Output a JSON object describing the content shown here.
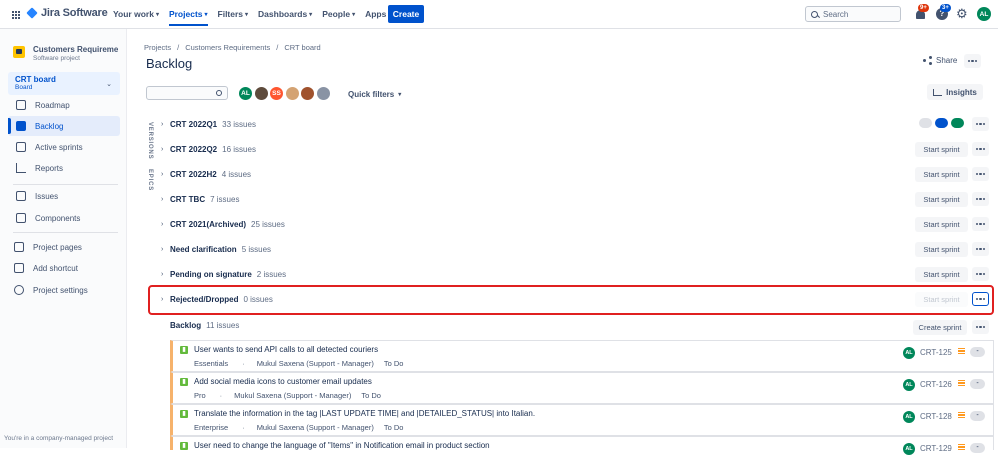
{
  "topnav": {
    "product": "Jira Software",
    "items": [
      {
        "label": "Your work"
      },
      {
        "label": "Projects"
      },
      {
        "label": "Filters"
      },
      {
        "label": "Dashboards"
      },
      {
        "label": "People"
      },
      {
        "label": "Apps"
      }
    ],
    "create_label": "Create",
    "search_placeholder": "Search",
    "notifications_badge": "9+",
    "help_badge": "3+",
    "user_initials": "AL"
  },
  "sidebar": {
    "project_name": "Customers Requireme",
    "project_type": "Software project",
    "board_name": "CRT board",
    "board_sub": "Board",
    "planning": [
      {
        "label": "Roadmap",
        "icon": "roadmap-icon"
      },
      {
        "label": "Backlog",
        "icon": "backlog-icon"
      },
      {
        "label": "Active sprints",
        "icon": "board-icon"
      },
      {
        "label": "Reports",
        "icon": "reports-icon"
      }
    ],
    "development": [
      {
        "label": "Issues",
        "icon": "issues-icon"
      },
      {
        "label": "Components",
        "icon": "components-icon"
      }
    ],
    "footer_items": [
      {
        "label": "Project pages",
        "icon": "pages-icon"
      },
      {
        "label": "Add shortcut",
        "icon": "add-shortcut-icon"
      },
      {
        "label": "Project settings",
        "icon": "settings-icon"
      }
    ],
    "footer_text": "You're in a company-managed project"
  },
  "main": {
    "breadcrumb": [
      "Projects",
      "Customers Requirements",
      "CRT board"
    ],
    "title": "Backlog",
    "share_label": "Share",
    "quick_filters_label": "Quick filters",
    "insights_label": "Insights",
    "versions_label": "VERSIONS",
    "epics_label": "EPICS",
    "avatars": [
      {
        "initials": "AL",
        "color": "#00875a"
      },
      {
        "initials": "",
        "color": "#5e4b3c"
      },
      {
        "initials": "SS",
        "color": "#ff5630"
      },
      {
        "initials": "",
        "color": "#d4a373"
      },
      {
        "initials": "",
        "color": "#a0522d"
      },
      {
        "initials": "",
        "color": "#8993a4"
      }
    ],
    "sprints": [
      {
        "name": "CRT 2022Q1",
        "count": "33 issues",
        "button": "",
        "status_pills": [
          "#dfe1e6",
          "#0052cc",
          "#00875a"
        ]
      },
      {
        "name": "CRT 2022Q2",
        "count": "16 issues",
        "button": "Start sprint"
      },
      {
        "name": "CRT 2022H2",
        "count": "4 issues",
        "button": "Start sprint"
      },
      {
        "name": "CRT TBC",
        "count": "7 issues",
        "button": "Start sprint"
      },
      {
        "name": "CRT 2021(Archived)",
        "count": "25 issues",
        "button": "Start sprint"
      },
      {
        "name": "Need clarification",
        "count": "5 issues",
        "button": "Start sprint"
      },
      {
        "name": "Pending on signature",
        "count": "2 issues",
        "button": "Start sprint"
      },
      {
        "name": "Rejected/Dropped",
        "count": "0 issues",
        "button": "Start sprint",
        "disabled": true
      }
    ],
    "backlog": {
      "name": "Backlog",
      "count": "11 issues",
      "create_sprint_label": "Create sprint",
      "issues": [
        {
          "summary": "User wants to send API calls to all detected couriers",
          "epic": "Essentials",
          "assignee": "Mukul Saxena (Support - Manager)",
          "status": "To Do",
          "key": "CRT-125",
          "avatar": "AL",
          "estimate": "-"
        },
        {
          "summary": "Add social media icons to customer email updates",
          "epic": "Pro",
          "assignee": "Mukul Saxena (Support - Manager)",
          "status": "To Do",
          "key": "CRT-126",
          "avatar": "AL",
          "estimate": "-"
        },
        {
          "summary": "Translate the information in the tag |LAST UPDATE TIME| and |DETAILED_STATUS| into Italian.",
          "epic": "Enterprise",
          "assignee": "Mukul Saxena (Support - Manager)",
          "status": "To Do",
          "key": "CRT-128",
          "avatar": "AL",
          "estimate": "-"
        },
        {
          "summary": "User need to change the language of \"Items\" in Notification email in product section",
          "epic": "",
          "assignee": "",
          "status": "",
          "key": "CRT-129",
          "avatar": "AL",
          "estimate": "-"
        }
      ]
    }
  }
}
